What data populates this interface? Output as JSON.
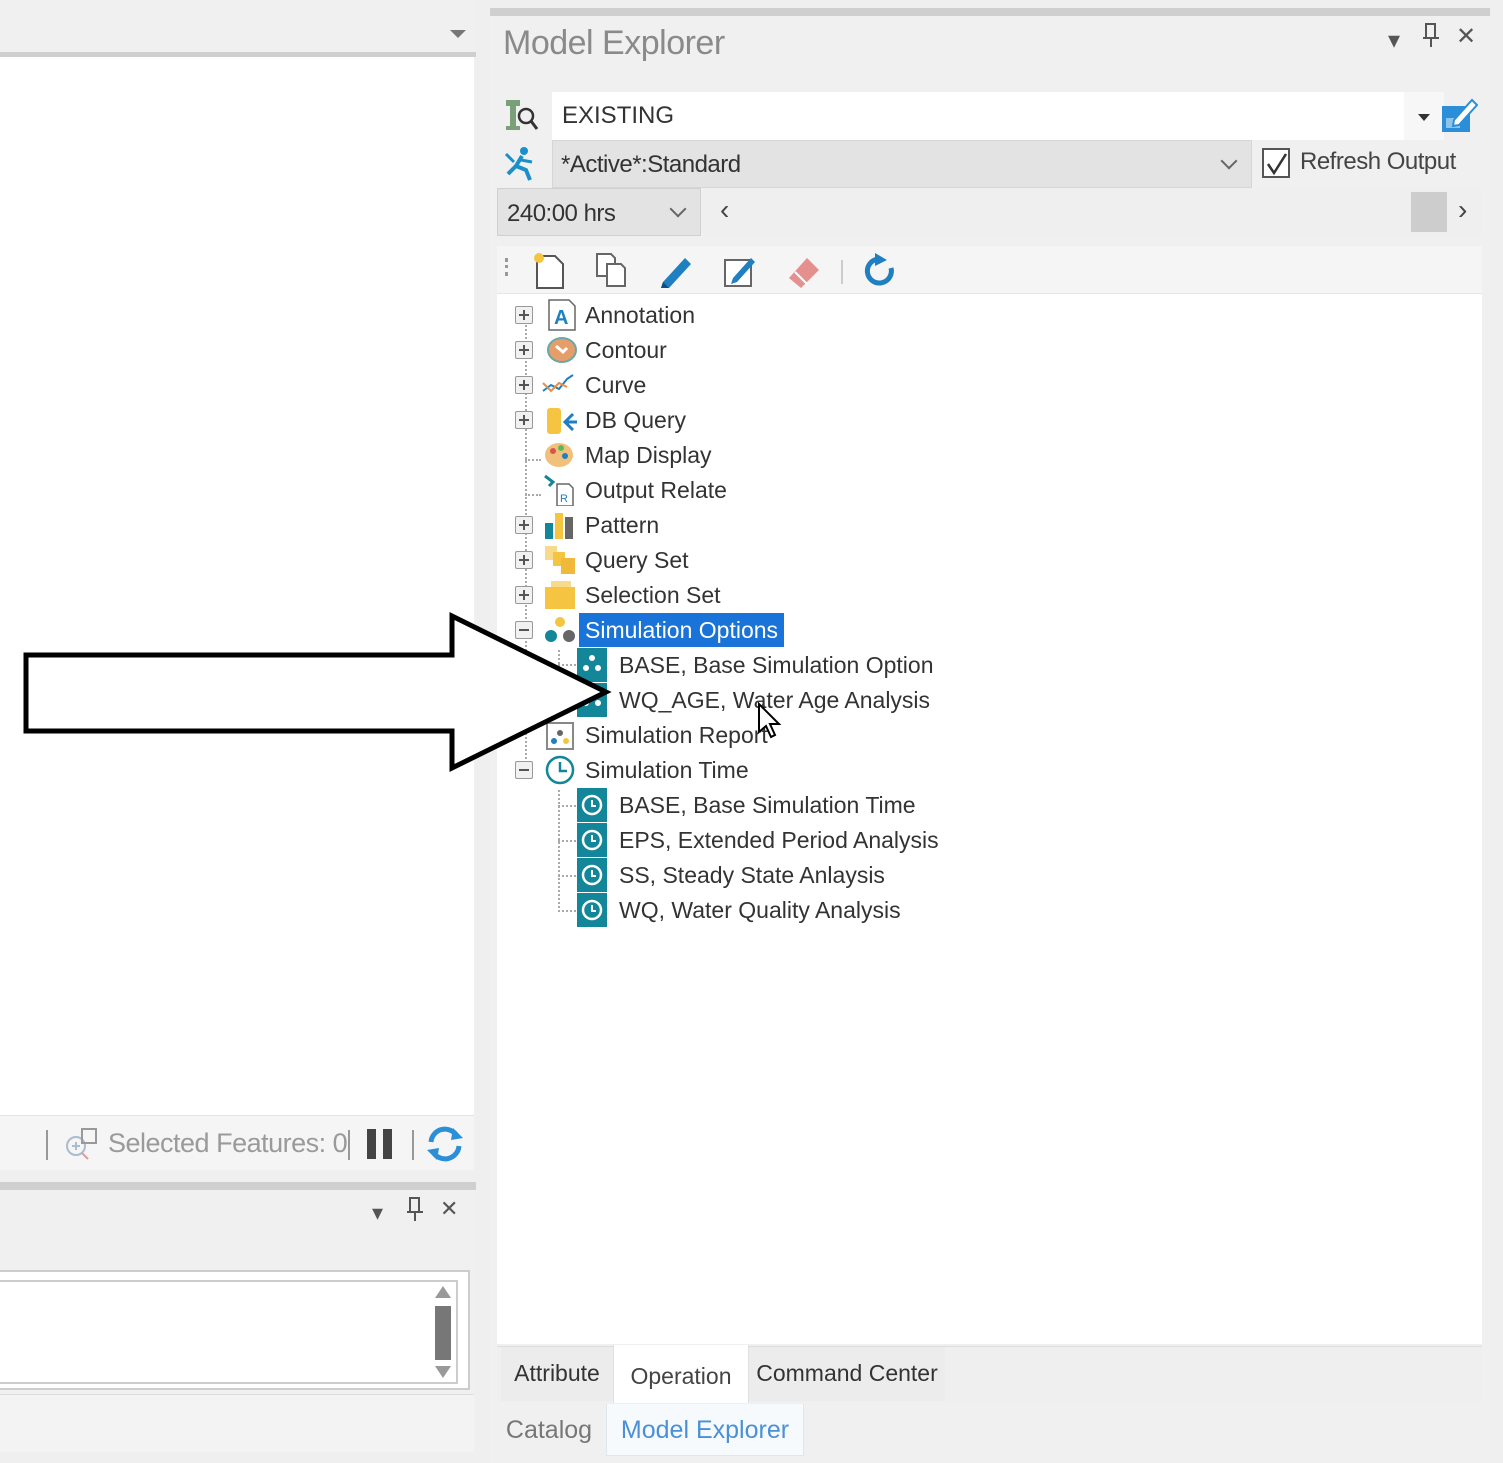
{
  "left_top_panel": {
    "status_bar": {
      "selected_features_label": "Selected Features: 0",
      "icons": [
        "select-features-icon",
        "pause-icon",
        "refresh-icon"
      ]
    }
  },
  "left_bottom_panel": {
    "controls": {
      "dropdown": "▾",
      "pin": "🖈",
      "close": "✕"
    }
  },
  "model_explorer": {
    "title": "Model Explorer",
    "window_controls": {
      "dropdown": "▾",
      "pin": "🖈",
      "close": "✕"
    },
    "scenario": {
      "value": "EXISTING"
    },
    "alternative": {
      "value": "*Active*:Standard"
    },
    "refresh_output": {
      "label": "Refresh Output",
      "checked": true
    },
    "time": {
      "value": "240:00 hrs",
      "prev": "‹",
      "next": "›"
    },
    "toolbar": [
      "new-icon",
      "copy-icon",
      "edit-pencil-icon",
      "edit-properties-icon",
      "delete-eraser-icon",
      "refresh-icon"
    ],
    "tree": [
      {
        "label": "Annotation",
        "icon": "annotation-icon",
        "expander": "plus"
      },
      {
        "label": "Contour",
        "icon": "contour-icon",
        "expander": "plus"
      },
      {
        "label": "Curve",
        "icon": "curve-icon",
        "expander": "plus"
      },
      {
        "label": "DB Query",
        "icon": "db-query-icon",
        "expander": "plus"
      },
      {
        "label": "Map Display",
        "icon": "map-display-icon",
        "expander": "none"
      },
      {
        "label": "Output Relate",
        "icon": "output-relate-icon",
        "expander": "none"
      },
      {
        "label": "Pattern",
        "icon": "pattern-icon",
        "expander": "plus"
      },
      {
        "label": "Query Set",
        "icon": "query-set-icon",
        "expander": "plus"
      },
      {
        "label": "Selection Set",
        "icon": "selection-set-icon",
        "expander": "plus"
      },
      {
        "label": "Simulation Options",
        "icon": "simulation-options-icon",
        "expander": "minus",
        "selected": true,
        "children": [
          {
            "label": "BASE, Base Simulation Option",
            "icon": "simulation-option-icon"
          },
          {
            "label": "WQ_AGE, Water Age Analysis",
            "icon": "simulation-option-icon"
          }
        ]
      },
      {
        "label": "Simulation Report",
        "icon": "simulation-report-icon",
        "expander": "none"
      },
      {
        "label": "Simulation Time",
        "icon": "clock-icon",
        "expander": "minus",
        "children": [
          {
            "label": "BASE, Base Simulation Time",
            "icon": "clock-icon"
          },
          {
            "label": "EPS, Extended Period Analysis",
            "icon": "clock-icon"
          },
          {
            "label": "SS, Steady State Anlaysis",
            "icon": "clock-icon"
          },
          {
            "label": "WQ, Water Quality Analysis",
            "icon": "clock-icon"
          }
        ]
      }
    ],
    "tabs_row1": [
      {
        "label": "Attribute",
        "active": false
      },
      {
        "label": "Operation",
        "active": true
      },
      {
        "label": "Command Center",
        "active": false
      }
    ],
    "tabs_row2": [
      {
        "label": "Catalog",
        "active": false
      },
      {
        "label": "Model Explorer",
        "active": true
      }
    ]
  },
  "colors": {
    "selection": "#1a73d9",
    "teal_icon": "#13869a",
    "active_tab_text": "#4a90d9"
  }
}
